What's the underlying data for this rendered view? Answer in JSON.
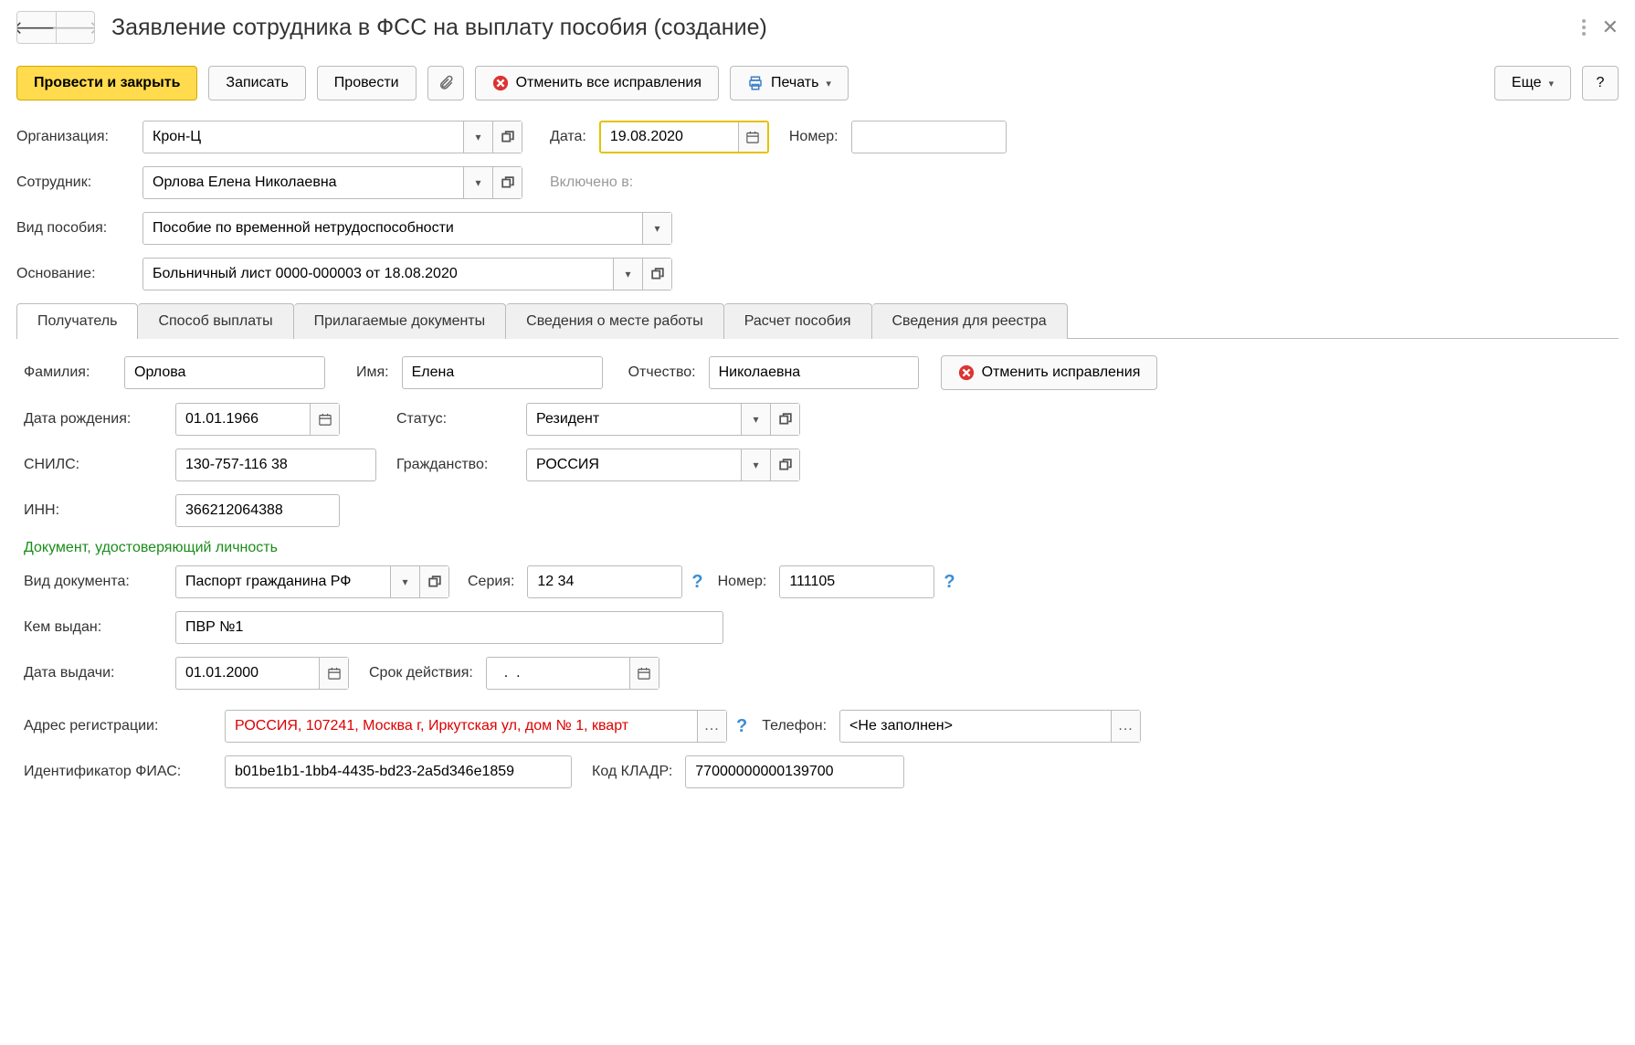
{
  "title": "Заявление сотрудника в ФСС на выплату пособия (создание)",
  "toolbar": {
    "post_close": "Провести и закрыть",
    "save": "Записать",
    "post": "Провести",
    "cancel_all": "Отменить все исправления",
    "print": "Печать",
    "more": "Еще",
    "help": "?"
  },
  "header_fields": {
    "org_label": "Организация:",
    "org_value": "Крон-Ц",
    "date_label": "Дата:",
    "date_value": "19.08.2020",
    "number_label": "Номер:",
    "number_value": "",
    "employee_label": "Сотрудник:",
    "employee_value": "Орлова Елена Николаевна",
    "included_label": "Включено в:",
    "benefit_type_label": "Вид пособия:",
    "benefit_type_value": "Пособие по временной нетрудоспособности",
    "basis_label": "Основание:",
    "basis_value": "Больничный лист 0000-000003 от 18.08.2020"
  },
  "tabs": [
    "Получатель",
    "Способ выплаты",
    "Прилагаемые документы",
    "Сведения о месте работы",
    "Расчет пособия",
    "Сведения для реестра"
  ],
  "recipient": {
    "lastname_label": "Фамилия:",
    "lastname": "Орлова",
    "firstname_label": "Имя:",
    "firstname": "Елена",
    "patronymic_label": "Отчество:",
    "patronymic": "Николаевна",
    "cancel_fixes": "Отменить исправления",
    "birthdate_label": "Дата рождения:",
    "birthdate": "01.01.1966",
    "status_label": "Статус:",
    "status": "Резидент",
    "snils_label": "СНИЛС:",
    "snils": "130-757-116 38",
    "citizenship_label": "Гражданство:",
    "citizenship": "РОССИЯ",
    "inn_label": "ИНН:",
    "inn": "366212064388",
    "id_doc_section": "Документ, удостоверяющий личность",
    "doc_type_label": "Вид документа:",
    "doc_type": "Паспорт гражданина РФ",
    "series_label": "Серия:",
    "series": "12 34",
    "doc_number_label": "Номер:",
    "doc_number": "111105",
    "issued_by_label": "Кем выдан:",
    "issued_by": "ПВР №1",
    "issue_date_label": "Дата выдачи:",
    "issue_date": "01.01.2000",
    "expiry_label": "Срок действия:",
    "expiry": "  .  .",
    "address_label": "Адрес регистрации:",
    "address": "РОССИЯ, 107241, Москва г, Иркутская ул, дом № 1, кварт",
    "phone_label": "Телефон:",
    "phone": "<Не заполнен>",
    "fias_label": "Идентификатор ФИАС:",
    "fias": "b01be1b1-1bb4-4435-bd23-2a5d346e1859",
    "kladr_label": "Код КЛАДР:",
    "kladr": "77000000000139700"
  }
}
